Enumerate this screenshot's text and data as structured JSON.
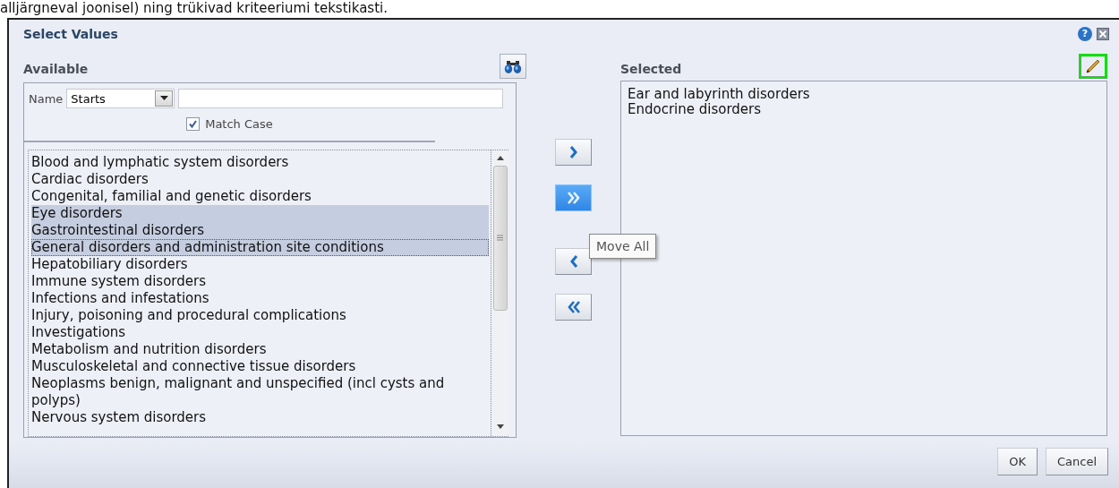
{
  "caption_fragment": "alljärgneval joonisel) ning trükivad kriteeriumi tekstikasti.",
  "dialog": {
    "title": "Select Values",
    "help": "?"
  },
  "available": {
    "heading": "Available",
    "filter": {
      "label": "Name",
      "operator": "Starts"
    },
    "match_case": {
      "label": "Match Case",
      "checked": true
    },
    "items": [
      {
        "text": "Blood and lymphatic system disorders",
        "selected": false,
        "focused": false
      },
      {
        "text": "Cardiac disorders",
        "selected": false,
        "focused": false
      },
      {
        "text": "Congenital, familial and genetic disorders",
        "selected": false,
        "focused": false
      },
      {
        "text": "Eye disorders",
        "selected": true,
        "focused": false
      },
      {
        "text": "Gastrointestinal disorders",
        "selected": true,
        "focused": false
      },
      {
        "text": "General disorders and administration site conditions",
        "selected": true,
        "focused": true
      },
      {
        "text": "Hepatobiliary disorders",
        "selected": false,
        "focused": false
      },
      {
        "text": "Immune system disorders",
        "selected": false,
        "focused": false
      },
      {
        "text": "Infections and infestations",
        "selected": false,
        "focused": false
      },
      {
        "text": "Injury, poisoning and procedural complications",
        "selected": false,
        "focused": false
      },
      {
        "text": "Investigations",
        "selected": false,
        "focused": false
      },
      {
        "text": "Metabolism and nutrition disorders",
        "selected": false,
        "focused": false
      },
      {
        "text": "Musculoskeletal and connective tissue disorders",
        "selected": false,
        "focused": false
      },
      {
        "text": "Neoplasms benign, malignant and unspecified (incl cysts and polyps)",
        "selected": false,
        "focused": false
      },
      {
        "text": "Nervous system disorders",
        "selected": false,
        "focused": false
      }
    ]
  },
  "move_buttons": [
    {
      "kind": "move",
      "hovered": false
    },
    {
      "kind": "move_all",
      "hovered": true
    },
    {
      "kind": "remove",
      "hovered": false
    },
    {
      "kind": "remove_all",
      "hovered": false
    }
  ],
  "tooltip": "Move All",
  "selected": {
    "heading": "Selected",
    "edit_highlighted": true,
    "items": [
      {
        "text": "Ear and labyrinth disorders"
      },
      {
        "text": "Endocrine disorders"
      }
    ]
  },
  "buttons": [
    {
      "label": "OK"
    },
    {
      "label": "Cancel"
    }
  ]
}
